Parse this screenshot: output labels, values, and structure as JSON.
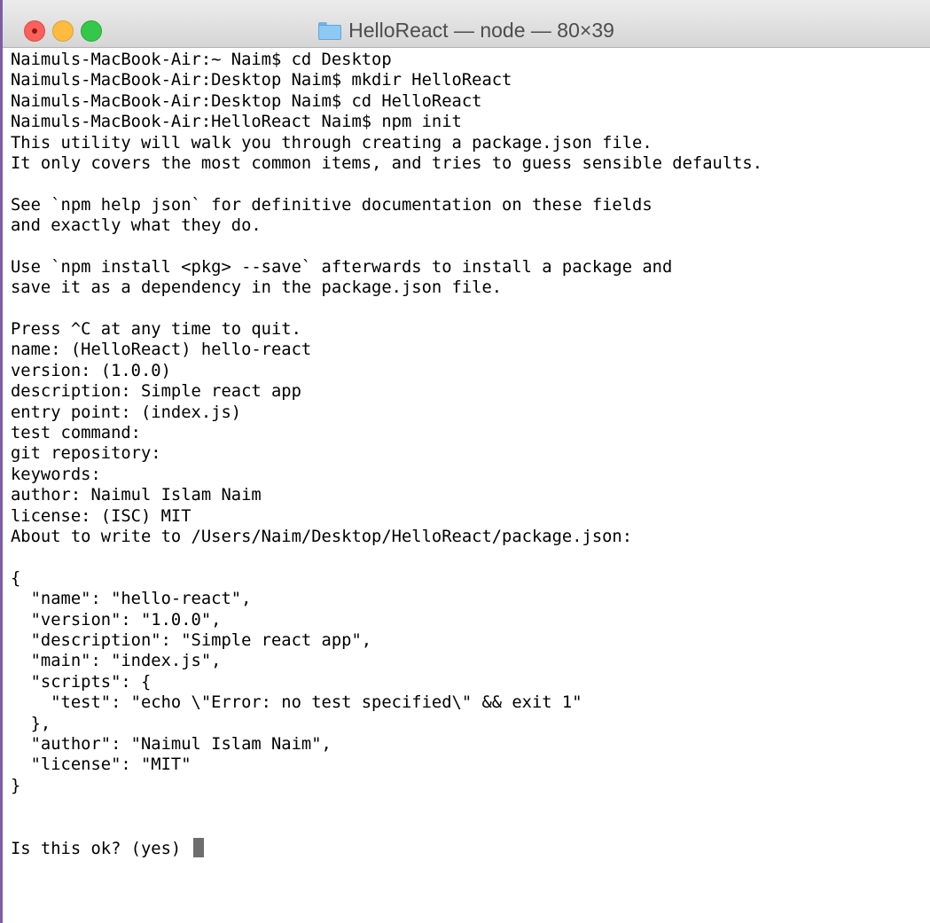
{
  "window": {
    "title": "HelloReact — node — 80×39"
  },
  "terminal": {
    "lines": [
      "Naimuls-MacBook-Air:~ Naim$ cd Desktop",
      "Naimuls-MacBook-Air:Desktop Naim$ mkdir HelloReact",
      "Naimuls-MacBook-Air:Desktop Naim$ cd HelloReact",
      "Naimuls-MacBook-Air:HelloReact Naim$ npm init",
      "This utility will walk you through creating a package.json file.",
      "It only covers the most common items, and tries to guess sensible defaults.",
      "",
      "See `npm help json` for definitive documentation on these fields",
      "and exactly what they do.",
      "",
      "Use `npm install <pkg> --save` afterwards to install a package and",
      "save it as a dependency in the package.json file.",
      "",
      "Press ^C at any time to quit.",
      "name: (HelloReact) hello-react",
      "version: (1.0.0)",
      "description: Simple react app",
      "entry point: (index.js)",
      "test command:",
      "git repository:",
      "keywords:",
      "author: Naimul Islam Naim",
      "license: (ISC) MIT",
      "About to write to /Users/Naim/Desktop/HelloReact/package.json:",
      "",
      "{",
      "  \"name\": \"hello-react\",",
      "  \"version\": \"1.0.0\",",
      "  \"description\": \"Simple react app\",",
      "  \"main\": \"index.js\",",
      "  \"scripts\": {",
      "    \"test\": \"echo \\\"Error: no test specified\\\" && exit 1\"",
      "  },",
      "  \"author\": \"Naimul Islam Naim\",",
      "  \"license\": \"MIT\"",
      "}",
      "",
      ""
    ],
    "prompt": "Is this ok? (yes) "
  }
}
